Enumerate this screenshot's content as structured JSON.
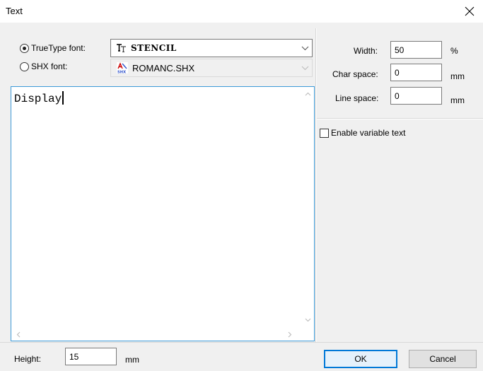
{
  "window": {
    "title": "Text"
  },
  "font": {
    "truetype_label": "TrueType font:",
    "shx_label": "SHX font:",
    "truetype_value": "STENCIL",
    "shx_value": "ROMANC.SHX",
    "truetype_icon": "tt-font-icon",
    "shx_icon": "shx-font-icon",
    "selected": "truetype"
  },
  "editor": {
    "content": "Display"
  },
  "params": {
    "width_label": "Width:",
    "width_value": "50",
    "width_unit": "%",
    "char_space_label": "Char space:",
    "char_space_value": "0",
    "char_space_unit": "mm",
    "line_space_label": "Line space:",
    "line_space_value": "0",
    "line_space_unit": "mm"
  },
  "variable_text": {
    "label": "Enable variable text",
    "checked": false
  },
  "height": {
    "label": "Height:",
    "value": "15",
    "unit": "mm"
  },
  "buttons": {
    "ok": "OK",
    "cancel": "Cancel"
  },
  "colors": {
    "focus": "#0078d7",
    "editor_border": "#3c9ad8",
    "dialog_bg": "#f0f0f0"
  }
}
